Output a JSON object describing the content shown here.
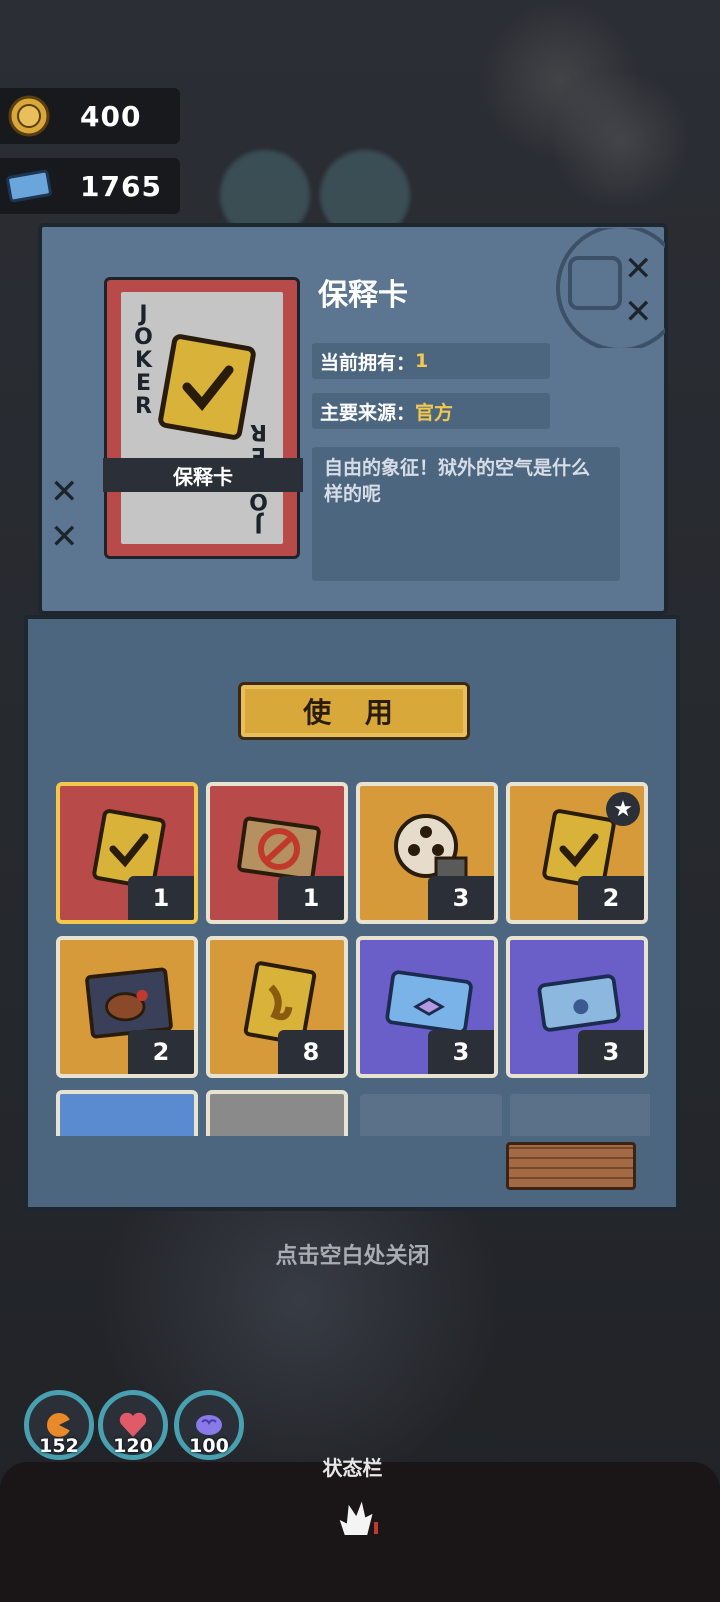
{
  "currency": {
    "coins": {
      "icon": "gold-coin-icon",
      "value": "400"
    },
    "tickets": {
      "icon": "blue-ticket-icon",
      "value": "1765"
    }
  },
  "detail": {
    "card_banner": "保释卡",
    "card_corner": "JOKER",
    "title": "保释卡",
    "owned_label": "当前拥有：",
    "owned_value": "1",
    "source_label": "主要来源：",
    "source_value": "官方",
    "description": "自由的象征！狱外的空气是什么样的呢"
  },
  "use_button": "使 用",
  "inventory": [
    {
      "icon": "bail-card-icon",
      "count": "1",
      "bg": "#b84a4a",
      "selected": true
    },
    {
      "icon": "forbidden-ticket-icon",
      "count": "1",
      "bg": "#b84a4a"
    },
    {
      "icon": "film-reel-icon",
      "count": "3",
      "bg": "#d69a3a"
    },
    {
      "icon": "bail-card-plus-icon",
      "count": "2",
      "bg": "#d69a3a",
      "badge": "star-badge-icon"
    },
    {
      "icon": "steak-meal-icon",
      "count": "2",
      "bg": "#d69a3a"
    },
    {
      "icon": "gold-ribbon-card-icon",
      "count": "8",
      "bg": "#d69a3a"
    },
    {
      "icon": "toy-ticket-icon",
      "count": "3",
      "bg": "#6a5fc9"
    },
    {
      "icon": "blue-pass-icon",
      "count": "3",
      "bg": "#6a5fc9"
    },
    {
      "icon": "partial-item-icon",
      "count": "",
      "bg": "#5a8ad0"
    },
    {
      "icon": "partial-item-icon",
      "count": "",
      "bg": "#8a8a8a"
    }
  ],
  "close_hint": "点击空白处关闭",
  "stats": [
    {
      "icon": "food-icon",
      "value": "152"
    },
    {
      "icon": "heart-icon",
      "value": "120"
    },
    {
      "icon": "brain-icon",
      "value": "100"
    }
  ],
  "status_bar": {
    "label": "状态栏",
    "icon": "flame-hand-icon"
  }
}
